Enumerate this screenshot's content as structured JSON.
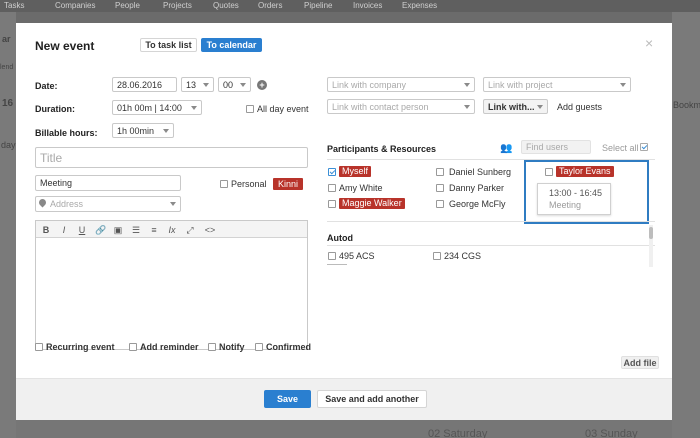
{
  "background": {
    "nav": [
      "Tasks",
      "Companies",
      "People",
      "Projects",
      "Quotes",
      "Orders",
      "Pipeline",
      "Invoices",
      "Expenses"
    ],
    "left_fragments": [
      "ar",
      "lend",
      "16",
      "day"
    ],
    "right_fragment": "Bookm",
    "bottom_dates": [
      "02 Saturday",
      "03 Sunday"
    ]
  },
  "modal": {
    "title": "New event",
    "close_glyph": "×",
    "tabs": {
      "task_list": "To task list",
      "calendar": "To calendar"
    }
  },
  "form": {
    "date_label": "Date:",
    "date_value": "28.06.2016",
    "hour_value": "13",
    "minute_value": "00",
    "add_glyph": "+",
    "duration_label": "Duration:",
    "duration_value": "01h 00m  |  14:00",
    "all_day_label": "All day event",
    "billable_label": "Billable hours:",
    "billable_value": "1h 00min",
    "title_placeholder": "Title",
    "type_value": "Meeting",
    "personal_label": "Personal",
    "kinni_label": "Kinni",
    "address_placeholder": "Address",
    "toolbar": [
      "B",
      "I",
      "U",
      "🔗",
      "▣",
      "☰",
      "≡",
      "Ix",
      "⤢",
      "<>"
    ],
    "options": {
      "recurring": "Recurring event",
      "reminder": "Add reminder",
      "notify": "Notify",
      "confirmed": "Confirmed"
    }
  },
  "links": {
    "company_placeholder": "Link with company",
    "project_placeholder": "Link with project",
    "contact_placeholder": "Link with contact person",
    "link_with": "Link with...",
    "add_guests": "Add guests"
  },
  "participants": {
    "heading": "Participants & Resources",
    "find_placeholder": "Find users",
    "select_all": "Select all",
    "people": [
      {
        "name": "Myself",
        "checked": true,
        "busy": true
      },
      {
        "name": "Daniel Sunberg",
        "checked": false,
        "busy": false
      },
      {
        "name": "Taylor Evans",
        "checked": false,
        "busy": true
      },
      {
        "name": "Amy White",
        "checked": false,
        "busy": false
      },
      {
        "name": "Danny Parker",
        "checked": false,
        "busy": false
      },
      {
        "name": "Maggie Walker",
        "checked": false,
        "busy": true
      },
      {
        "name": "George McFly",
        "checked": false,
        "busy": false
      }
    ],
    "tooltip": {
      "time": "13:00 - 16:45",
      "type": "Meeting"
    },
    "cars_heading": "Autod",
    "cars": [
      "495 ACS",
      "234 CGS"
    ]
  },
  "footer": {
    "add_file": "Add file",
    "save": "Save",
    "save_another": "Save and add another"
  },
  "colors": {
    "accent": "#2a7fd0",
    "busy": "#b8332a",
    "highlight": "#2f7cc2"
  }
}
